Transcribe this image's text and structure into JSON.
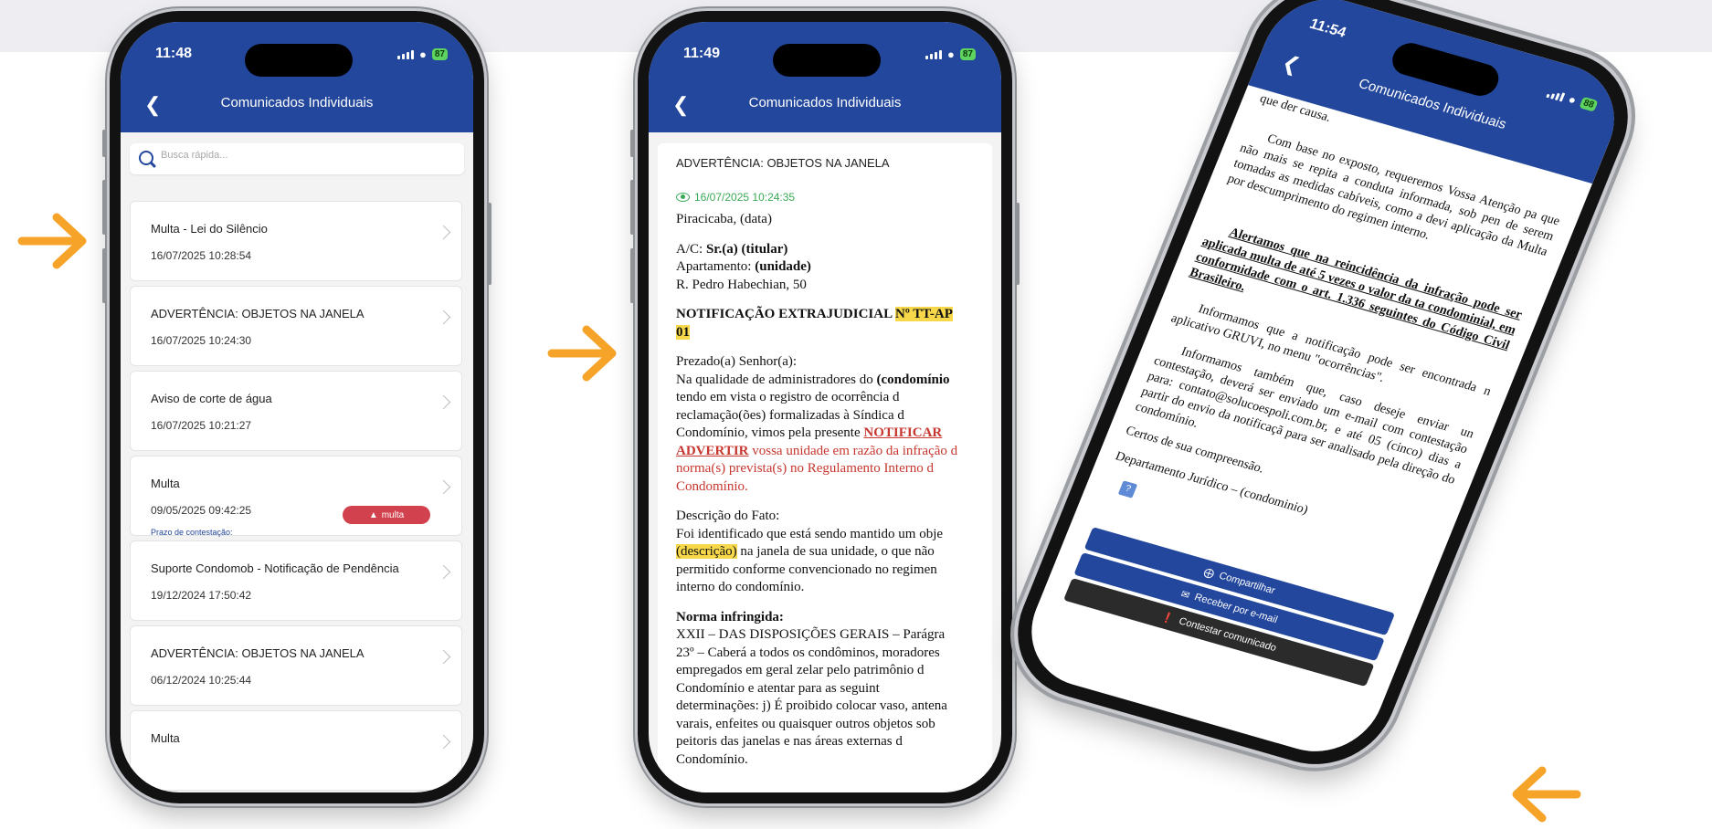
{
  "colors": {
    "accent": "#23479d",
    "arrow": "#f6a429",
    "badge": "#d2424e",
    "seen": "#3aa956",
    "highlight": "#f6d84a"
  },
  "phone1": {
    "time": "11:48",
    "battery": "87",
    "header_title": "Comunicados Individuais",
    "search_placeholder": "Busca rápida...",
    "items": [
      {
        "title": "Multa - Lei do Silêncio",
        "date": "16/07/2025 10:28:54"
      },
      {
        "title": "ADVERTÊNCIA: OBJETOS NA JANELA",
        "date": "16/07/2025 10:24:30"
      },
      {
        "title": "Aviso de corte de água",
        "date": "16/07/2025 10:21:27"
      },
      {
        "title": "Multa",
        "date": "09/05/2025 09:42:25",
        "deadline": "Prazo de contestação:",
        "badge": "multa"
      },
      {
        "title": "Suporte Condomob - Notificação de Pendência",
        "date": "19/12/2024 17:50:42"
      },
      {
        "title": "ADVERTÊNCIA: OBJETOS NA JANELA",
        "date": "06/12/2024 10:25:44"
      },
      {
        "title": "Multa",
        "date": ""
      }
    ]
  },
  "phone2": {
    "time": "11:49",
    "battery": "87",
    "header_title": "Comunicados Individuais",
    "subject": "ADVERTÊNCIA: OBJETOS NA JANELA",
    "seen": "16/07/2025 10:24:35",
    "place": "Piracicaba, (data)",
    "ac_label": "A/C: ",
    "ac_value": "Sr.(a) (titular)",
    "apt_label": "Apartamento: ",
    "apt_value": "(unidade)",
    "address": "R. Pedro Habechian, 50",
    "notif_title": "NOTIFICAÇÃO EXTRAJUDICIAL ",
    "notif_num_1": "Nº TT-AP",
    "notif_num_2": "01",
    "greeting": "Prezado(a) Senhor(a):",
    "p1_l1a": "Na qualidade de administradores do ",
    "p1_l1b": "(condomínio",
    "p1_l2": "tendo em vista o registro de ocorrência d",
    "p1_l3": "reclamação(ões) formalizadas à Síndica d",
    "p1_l4a": "Condomínio, vimos pela presente ",
    "p1_l4b": "NOTIFICAR",
    "p1_l5a": "ADVERTIR",
    "p1_l5b": " vossa unidade em razão da infração d",
    "p1_l6": "norma(s) prevista(s) no Regulamento Interno d",
    "p1_l7": "Condomínio.",
    "fact_label": "Descrição do Fato:",
    "fact_l1": "Foi identificado que está sendo mantido um obje",
    "fact_l2a": "(descrição)",
    "fact_l2b": " na janela de sua unidade, o que não",
    "fact_l3": "permitido conforme convencionado no regimen",
    "fact_l4": "interno do condomínio.",
    "norm_label": "Norma infringida:",
    "norm_l1": "XXII – DAS DISPOSIÇÕES GERAIS – Parágra",
    "norm_l2": "23º – Caberá a todos os condôminos, moradores",
    "norm_l3": "empregados em geral zelar pelo patrimônio d",
    "norm_l4": "Condomínio e atentar para as seguint",
    "norm_l5": "determinações: j) É proibido colocar vaso, antena",
    "norm_l6": "varais, enfeites ou quaisquer outros objetos sob",
    "norm_l7": "peitoris das janelas e nas áreas externas d",
    "norm_l8": "Condomínio."
  },
  "phone3": {
    "time": "11:54",
    "battery": "88",
    "header_title": "Comunicados Individuais",
    "t0": "que der causa.",
    "t1": "Com base no exposto, requeremos Vossa Atenção pa que não mais se repita a conduta informada, sob pen de serem tomadas as medidas cabíveis, como a devi aplicação da Multa por descumprimento do regimen interno.",
    "t2": "Alertamos que na reincidência da infração pode ser aplicada multa de até 5 vezes o valor da ta condominial, em conformidade com o art. 1.336 seguintes do Código Civil Brasileiro.",
    "t3": "Informamos que a notificação pode ser encontrada n aplicativo GRUVI, no menu \"ocorrências\".",
    "t4": "Informamos também que, caso deseje enviar un contestação, deverá ser enviado um e-mail com contestação para: contato@solucoespoli.com.br, e até 05 (cinco) dias a partir do envio da notificaçã para ser analisado pela direção do condomínio.",
    "t5": "Certos de sua compreensão.",
    "t6": "Departamento Jurídico – (condominio)",
    "btn_share": "Compartilhar",
    "btn_email": "Receber por e-mail",
    "btn_contest": "Contestar comunicado"
  }
}
